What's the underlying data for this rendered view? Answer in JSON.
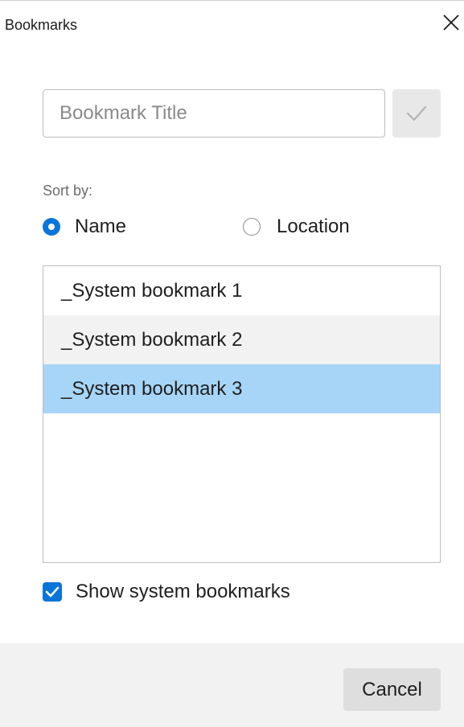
{
  "window": {
    "title": "Bookmarks",
    "close_icon": "close-icon"
  },
  "title_field": {
    "value": "",
    "placeholder": "Bookmark Title"
  },
  "confirm_button": {
    "icon": "checkmark-icon",
    "enabled": false
  },
  "sort": {
    "label": "Sort by:",
    "options": [
      {
        "label": "Name",
        "checked": true
      },
      {
        "label": "Location",
        "checked": false
      }
    ]
  },
  "bookmarks": {
    "items": [
      {
        "label": "_System bookmark 1",
        "state": "normal"
      },
      {
        "label": "_System bookmark 2",
        "state": "hover"
      },
      {
        "label": "_System bookmark 3",
        "state": "selected"
      }
    ]
  },
  "show_system": {
    "label": "Show system bookmarks",
    "checked": true
  },
  "footer": {
    "cancel_label": "Cancel"
  },
  "colors": {
    "accent": "#0a74d9",
    "selection": "#a6d5f7",
    "hover": "#f2f2f2",
    "footer_bg": "#f2f2f2",
    "button_bg": "#dedede"
  }
}
